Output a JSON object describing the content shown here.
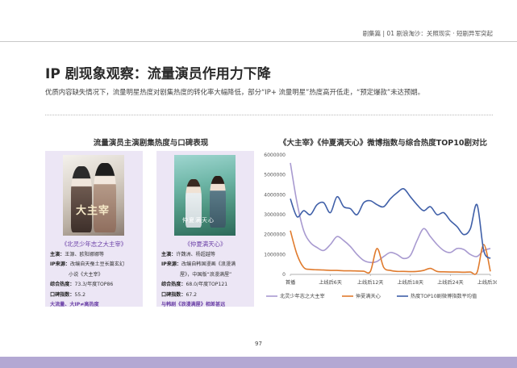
{
  "header": {
    "text": "剧集篇 | 01  剧浪淘沙：关照现实 · 短剧异军突起"
  },
  "title": "IP 剧现象观察：流量演员作用力下降",
  "subtitle": "优质内容缺失情况下，流量明星热度对剧集热度的转化率大幅降低，部分“IP+ 流量明星”热度高开低走，“预定爆款”未达预期。",
  "left_section": {
    "title": "流量演员主演剧集热度与口碑表现",
    "cards": [
      {
        "poster_text": "大主宰",
        "name": "《北灵少年志之大主宰》",
        "lead_label": "主演：",
        "lead": "王源、欧阳娜娜等",
        "ip_label": "IP来源：",
        "ip": "改编自天蚕土豆长篇玄幻",
        "ip2": "小说《大主宰》",
        "heat_label": "综合热度：",
        "heat": "73.3/年度TOP86",
        "rep_label": "口碑指数：",
        "rep": "55.2",
        "tag": "大流量、大IP≠高热度"
      },
      {
        "poster_text": "仲夏满天心",
        "name": "《仲夏满天心》",
        "lead_label": "主演：",
        "lead": "许魏洲、杨超越等",
        "ip_label": "IP来源：",
        "ip": "改编自韩国漫画《浪漫满",
        "ip2": "屋》，中国版“浪漫满屋”",
        "heat_label": "综合热度：",
        "heat": "68.0/年度TOP121",
        "rep_label": "口碑指数：",
        "rep": "67.2",
        "tag": "与韩剧《浪漫满屋》相差甚远"
      }
    ]
  },
  "chart_data": {
    "type": "line",
    "title": "《大主宰》《仲夏满天心》微博指数与综合热度TOP10剧对比",
    "xlabel": "",
    "ylabel": "",
    "ylim": [
      0,
      6000000
    ],
    "yticks": [
      "0",
      "1000000",
      "2000000",
      "3000000",
      "4000000",
      "5000000",
      "6000000"
    ],
    "x_labels": [
      {
        "index": 0,
        "label": "首播"
      },
      {
        "index": 6,
        "label": "上线后6天"
      },
      {
        "index": 12,
        "label": "上线后12天"
      },
      {
        "index": 18,
        "label": "上线后18天"
      },
      {
        "index": 24,
        "label": "上线后24天"
      },
      {
        "index": 30,
        "label": "上线后30天"
      }
    ],
    "x_count": 31,
    "legend_position": "bottom",
    "series": [
      {
        "name": "北灵少年志之大主宰",
        "color": "#a89ad0",
        "values": [
          5600000,
          3600000,
          2200000,
          1600000,
          1350000,
          1200000,
          1500000,
          1900000,
          1700000,
          1400000,
          1000000,
          700000,
          600000,
          650000,
          900000,
          1100000,
          1000000,
          800000,
          950000,
          1700000,
          2300000,
          1900000,
          1500000,
          1200000,
          1100000,
          1300000,
          1250000,
          1000000,
          900000,
          1200000,
          1300000
        ]
      },
      {
        "name": "仲夏满天心",
        "color": "#e07b2e",
        "values": [
          2200000,
          1000000,
          350000,
          250000,
          230000,
          220000,
          200000,
          200000,
          180000,
          180000,
          170000,
          160000,
          150000,
          1300000,
          350000,
          200000,
          150000,
          150000,
          140000,
          150000,
          200000,
          300000,
          150000,
          130000,
          120000,
          120000,
          110000,
          120000,
          100000,
          1500000,
          150000
        ]
      },
      {
        "name": "热度TOP10剧微博指数平均值",
        "color": "#3f5fa8",
        "values": [
          3800000,
          2900000,
          3200000,
          3000000,
          3500000,
          3600000,
          3100000,
          3900000,
          3400000,
          3300000,
          3000000,
          3600000,
          3700000,
          3500000,
          3400000,
          3800000,
          4100000,
          4300000,
          3900000,
          3500000,
          3200000,
          3400000,
          3000000,
          3100000,
          2700000,
          2400000,
          2000000,
          2300000,
          3500000,
          1200000,
          800000
        ]
      }
    ]
  },
  "page_number": "97"
}
